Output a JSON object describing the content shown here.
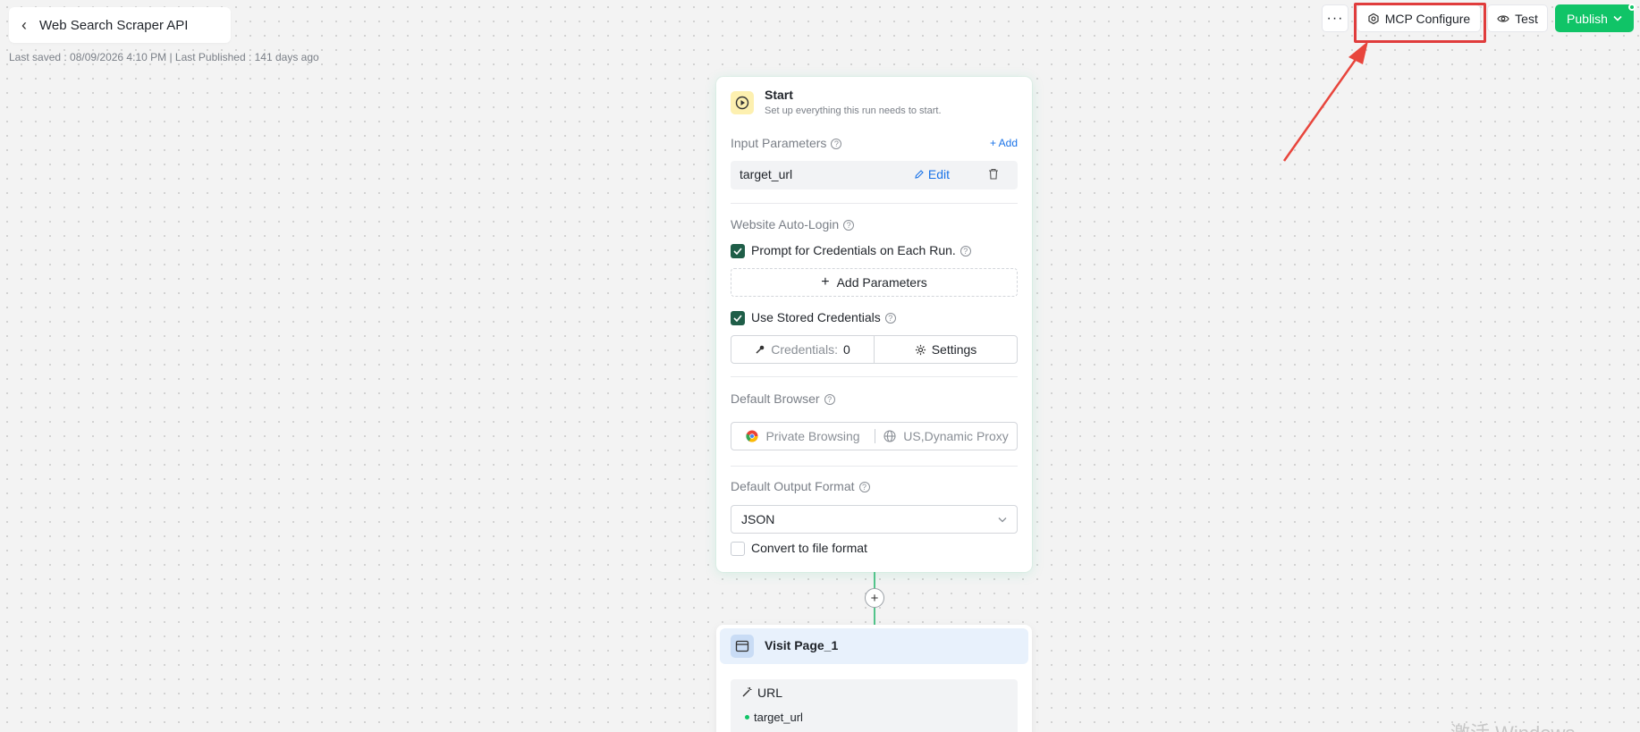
{
  "header": {
    "title": "Web Search Scraper API",
    "save_info": "Last saved : 08/09/2026 4:10 PM | Last Published : 141 days ago"
  },
  "toolbar": {
    "more_label": "···",
    "mcp_label": "MCP Configure",
    "test_label": "Test",
    "publish_label": "Publish",
    "accent": "#10c467"
  },
  "start_node": {
    "title": "Start",
    "subtitle": "Set up everything this run needs to start.",
    "input_params_label": "Input Parameters",
    "add_label": "Add",
    "param_name": "target_url",
    "edit_label": "Edit",
    "auto_login_label": "Website Auto-Login",
    "prompt_credentials_label": "Prompt for Credentials on Each Run.",
    "prompt_credentials_checked": true,
    "add_parameters_label": "Add Parameters",
    "use_stored_label": "Use Stored Credentials",
    "use_stored_checked": true,
    "credentials_label": "Credentials:",
    "credentials_count": "0",
    "settings_label": "Settings",
    "default_browser_label": "Default Browser",
    "browser_mode": "Private Browsing",
    "proxy": "US,Dynamic Proxy",
    "output_format_label": "Default Output Format",
    "output_format_value": "JSON",
    "convert_label": "Convert to file format",
    "convert_checked": false
  },
  "visit_node": {
    "title": "Visit Page_1",
    "url_label": "URL",
    "url_value": "target_url"
  },
  "watermark": "激活 Windows"
}
